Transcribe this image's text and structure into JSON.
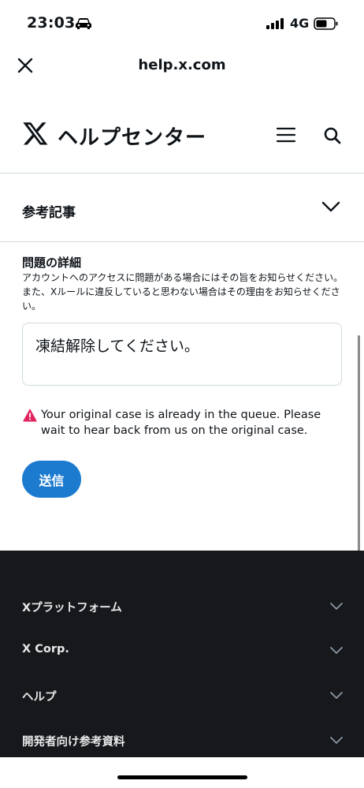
{
  "status_bar": {
    "time": "23:03",
    "network": "4G",
    "icons": [
      "car-icon",
      "signal-icon",
      "battery-icon"
    ]
  },
  "browser": {
    "url": "help.x.com",
    "close_icon": "close-icon"
  },
  "header": {
    "logo_icon": "x-logo-icon",
    "title": "ヘルプセンター",
    "menu_icon": "menu-icon",
    "search_icon": "search-icon"
  },
  "related": {
    "label": "参考記事",
    "icon": "chevron-down-icon"
  },
  "issue": {
    "title": "問題の詳細",
    "description": "アカウントへのアクセスに問題がある場合にはその旨をお知らせください。また、Xルールに違反していると思わない場合はその理由をお知らせください。",
    "value": "凍結解除してください。"
  },
  "error": {
    "message": "Your original case is already in the queue. Please wait to hear back from us on the original case.",
    "icon": "warning-icon",
    "color": "#e0245e"
  },
  "submit": {
    "label": "送信",
    "color": "#1d7bcf"
  },
  "footer": {
    "background": "#16181c",
    "items": [
      {
        "label": "Xプラットフォーム"
      },
      {
        "label": "X Corp."
      },
      {
        "label": "ヘルプ"
      },
      {
        "label": "開発者向け参考資料"
      }
    ]
  }
}
